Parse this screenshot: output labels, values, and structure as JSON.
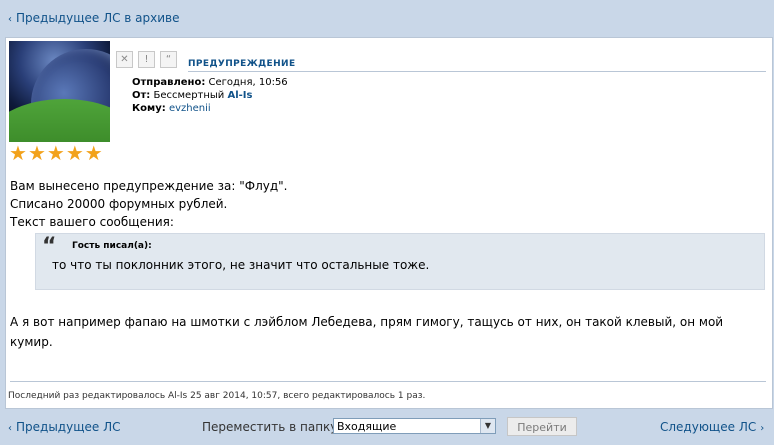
{
  "topnav": {
    "arrow": "‹",
    "prev_archive": "Предыдущее ЛС в архиве"
  },
  "post": {
    "rating_stars": 5,
    "controls": [
      "✕",
      "!",
      "“"
    ],
    "subject": "ПРЕДУПРЕЖДЕНИЕ",
    "sent_label": "Отправлено:",
    "sent_value": "Сегодня, 10:56",
    "from_label": "От:",
    "from_prefix": "Бессмертный",
    "from_user": "Al-Is",
    "to_label": "Кому:",
    "to_user": "evzhenii",
    "body_line1": "Вам вынесено предупреждение за: \"Флуд\".",
    "body_line2": "Списано 20000 форумных рублей.",
    "body_line3": "Текст вашего сообщения:",
    "quote_mark": "“",
    "quote_author": "Гость писал(а):",
    "quote_text": "то что ты поклонник этого, не значит что остальные тоже.",
    "message": "А я вот например фапаю на шмотки с лэйблом Лебедева, прям гимогу, тащусь от них, он такой клевый, он мой кумир.",
    "edit_note": "Последний раз редактировалось Al-Is 25 авг 2014, 10:57, всего редактировалось 1 раз."
  },
  "bottom": {
    "arrow_left": "‹",
    "prev": "Предыдущее ЛС",
    "move_label": "Переместить в папку:",
    "folder_selected": "Входящие",
    "go_button": "Перейти",
    "next": "Следующее ЛС",
    "arrow_right": "›"
  },
  "colors": {
    "accent": "#105289",
    "background": "#c9d7e8",
    "stars": "#f2a21b"
  }
}
